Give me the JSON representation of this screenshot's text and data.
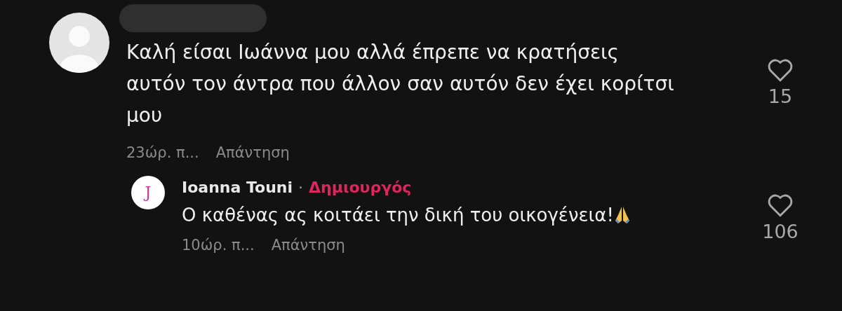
{
  "comments": [
    {
      "text": "Καλή είσαι Ιωάννα μου αλλά έπρεπε να κρατήσεις αυτόν τον άντρα που άλλον σαν αυτόν δεν έχει κορίτσι μου",
      "time": "23ώρ. π...",
      "reply": "Απάντηση",
      "likes": "15",
      "liked": false,
      "kind": "comment",
      "replies": [
        {
          "author": "Ioanna Touni",
          "separator": "·",
          "badge": "Δημιουργός",
          "text": "Ο καθένας ας κοιτάει την δική του οικογένεια!",
          "time": "10ώρ. π...",
          "reply": "Απάντηση",
          "likes": "106",
          "liked": false,
          "avatar_letter": "J"
        }
      ]
    }
  ]
}
